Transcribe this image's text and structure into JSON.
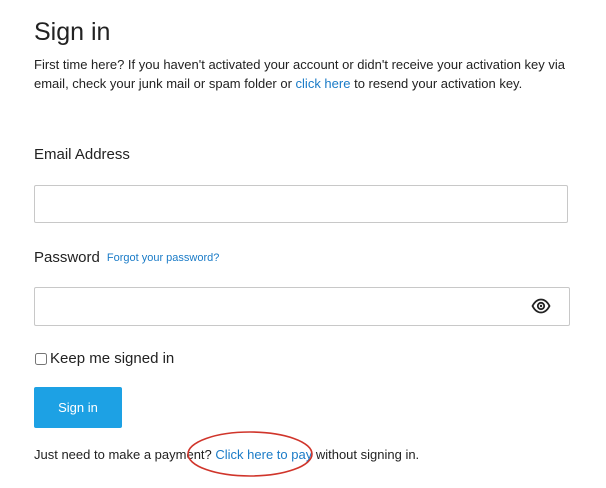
{
  "page": {
    "title": "Sign in"
  },
  "intro": {
    "text_before": "First time here? If you haven't activated your account or didn't receive your activation key via email, check your junk mail or spam folder or ",
    "link_text": "click here",
    "text_after": " to resend your activation key."
  },
  "email": {
    "label": "Email Address",
    "value": "",
    "placeholder": ""
  },
  "password": {
    "label": "Password",
    "forgot_link": "Forgot your password?",
    "value": "",
    "placeholder": "",
    "toggle_icon": "eye-icon"
  },
  "keep_signed_in": {
    "label": "Keep me signed in",
    "checked": false
  },
  "signin_button": {
    "label": "Sign in"
  },
  "footer": {
    "text_before": "Just need to make a payment? ",
    "link_text": "Click here to pay",
    "text_after": " without signing in."
  },
  "colors": {
    "link": "#1a7bc7",
    "button": "#1da1e4",
    "annotation": "#d0352b"
  }
}
